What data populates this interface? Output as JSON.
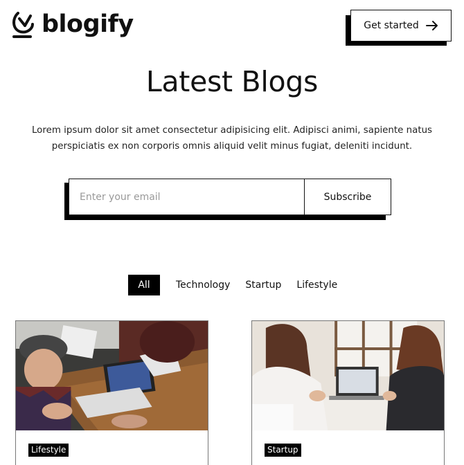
{
  "header": {
    "logo_text": "blogify",
    "logo_icon": "satellite-dish-icon",
    "cta_label": "Get started",
    "cta_icon": "arrow-right-icon"
  },
  "hero": {
    "title": "Latest Blogs",
    "intro": "Lorem ipsum dolor sit amet consectetur adipisicing elit. Adipisci animi, sapiente natus perspiciatis ex non corporis omnis aliquid velit minus fugiat, deleniti incidunt."
  },
  "subscribe": {
    "placeholder": "Enter your email",
    "value": "",
    "button_label": "Subscribe"
  },
  "filters": {
    "items": [
      "All",
      "Technology",
      "Startup",
      "Lifestyle"
    ],
    "active": "All"
  },
  "cards": [
    {
      "tag": "Lifestyle",
      "image": "meeting-with-laptops-photo"
    },
    {
      "tag": "Startup",
      "image": "two-women-at-laptop-photo"
    }
  ],
  "colors": {
    "accent": "#000000",
    "background": "#ffffff",
    "text": "#111111"
  }
}
